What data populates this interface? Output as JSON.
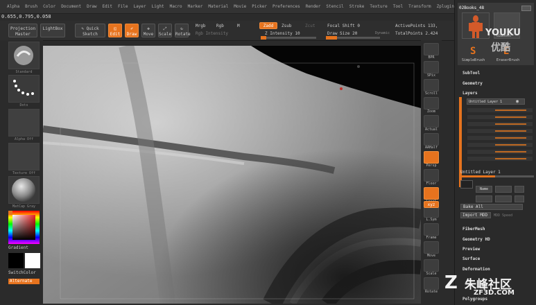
{
  "app": {
    "menu": [
      "Alpha",
      "Brush",
      "Color",
      "Document",
      "Draw",
      "Edit",
      "File",
      "Layer",
      "Light",
      "Macro",
      "Marker",
      "Material",
      "Movie",
      "Picker",
      "Preferences",
      "Render",
      "Stencil",
      "Stroke",
      "Texture",
      "Tool",
      "Transform",
      "Zplugin",
      "Zscript"
    ],
    "coords": "0.655,0.795,0.058"
  },
  "toolbar": {
    "projection_master": "Projection Master",
    "lightbox": "LightBox",
    "quick_sketch": "Quick Sketch",
    "edit": "Edit",
    "draw": "Draw",
    "move": "Move",
    "scale": "Scale",
    "rotate": "Rotate",
    "mrgb": "Mrgb",
    "rgb": "Rgb",
    "m": "M",
    "rgb_intensity": "Rgb Intensity",
    "zadd": "Zadd",
    "zsub": "Zsub",
    "zcut": "Zcut",
    "z_intensity": "Z Intensity 10",
    "focal_shift": "Focal Shift 0",
    "draw_size": "Draw Size 20",
    "dynamic": "Dynamic",
    "active_points": "ActivePoints 133,",
    "total_points": "TotalPoints 2.424",
    "z_intensity_level": 0.1,
    "draw_size_level": 0.2
  },
  "left_shelf": {
    "standard": "Standard",
    "dots": "Dots",
    "alpha_off": "Alpha Off",
    "texture_off": "Texture Off",
    "material_label": "MatCap Gray",
    "gradient": "Gradient",
    "switch_color": "SwitchColor",
    "alternate": "Alternate"
  },
  "right_shelf": [
    "BPR",
    "SPix",
    "Scroll",
    "Zoom",
    "Actual",
    "AAHalf",
    "Persp",
    "Floor",
    "Local",
    "L.Sym",
    "Frame",
    "Move",
    "Scale",
    "Rotate"
  ],
  "right_shelf_small": "xyz",
  "tray": {
    "tool_name": "02Books_48",
    "subtool_thumb_label": "02Books",
    "simple_brush": "SimpleBrush",
    "eraser_brush": "EraserBrush",
    "subtool": "SubTool",
    "geometry": "Geometry",
    "layers": "Layers",
    "layer_name": "Untitled Layer 1",
    "layer_name_bottom": "Untitled Layer 1",
    "name_btn": "Name",
    "bake_all": "Bake All",
    "import_mdd": "Import MDD",
    "mdd_speed": "MDD Speed",
    "fibermesh": "FiberMesh",
    "geometry_hd": "Geometry HD",
    "preview": "Preview",
    "surface": "Surface",
    "deformation": "Deformation",
    "polygroups": "Polygroups"
  },
  "watermarks": {
    "youku": "YOUKU",
    "youku_cn": "优酷",
    "zf3d": "ZF3D.COM",
    "zf3d_cn": "朱峰社区"
  },
  "colors": {
    "accent": "#e6731e",
    "primary_color": "#ffffff",
    "secondary_color": "#000000"
  }
}
